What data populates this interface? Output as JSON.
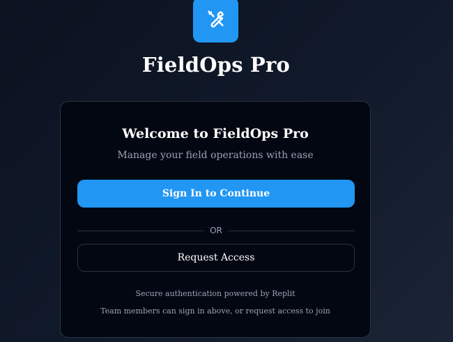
{
  "app": {
    "title": "FieldOps Pro",
    "logo_icon": "wrench-screwdriver-icon",
    "accent_color": "#2196f3"
  },
  "card": {
    "heading": "Welcome to FieldOps Pro",
    "subtitle": "Manage your field operations with ease",
    "signin_label": "Sign In to Continue",
    "divider_text": "OR",
    "request_access_label": "Request Access",
    "footnote_primary": "Secure authentication powered by Replit",
    "footnote_secondary": "Team members can sign in above, or request access to join"
  }
}
